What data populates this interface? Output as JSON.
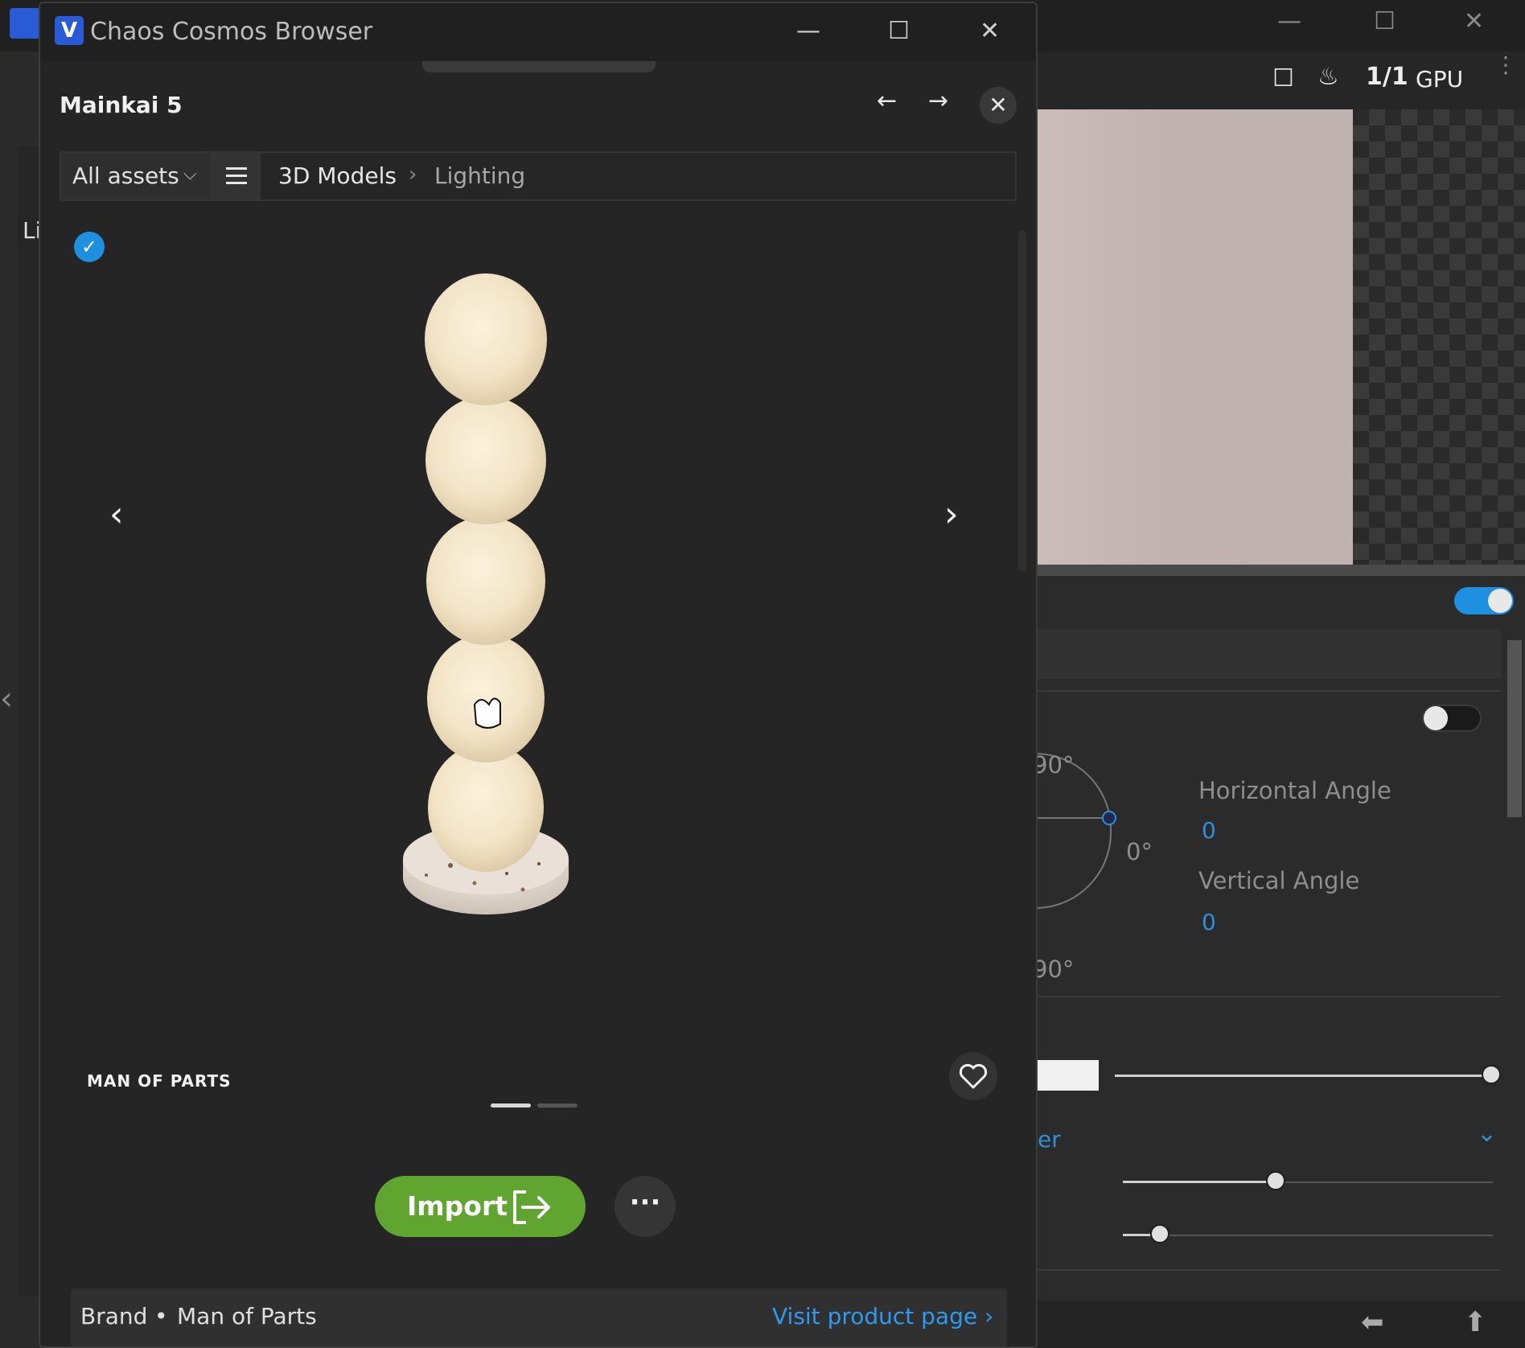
{
  "window": {
    "title": "Chaos Cosmos Browser",
    "minimize": "—",
    "maximize": "☐",
    "close": "✕"
  },
  "header": {
    "asset_name": "Mainkai 5",
    "back_icon": "arrow-left-icon",
    "forward_icon": "arrow-right-icon",
    "back_glyph": "←",
    "forward_glyph": "→",
    "close_glyph": "✕"
  },
  "nav": {
    "filter_label": "All assets",
    "filter_chevron": "⌵",
    "breadcrumb": [
      "3D Models",
      "Lighting"
    ],
    "breadcrumb_sep": "›"
  },
  "preview": {
    "check_glyph": "✓",
    "prev_glyph": "‹",
    "next_glyph": "›",
    "brand_logo_text": "MAN  OF   PARTS",
    "slide_count": 2,
    "active_slide": 1
  },
  "actions": {
    "import_label": "Import",
    "more_glyph": "···"
  },
  "info": {
    "brand_label": "Brand",
    "separator": "•",
    "brand_value": "Man of Parts",
    "visit_link": "Visit product page ›"
  },
  "background_app": {
    "left_cut_text": "Li",
    "toolbar": {
      "ratio": "1/1",
      "engine": "GPU"
    },
    "horizontal_angle_label": "Horizontal Angle",
    "horizontal_angle_value": "0",
    "vertical_angle_label": "Vertical Angle",
    "vertical_angle_value": "0",
    "dial_top": "90°",
    "dial_right": "0°",
    "dial_bottom": "90°",
    "cut_text": "er",
    "toggle_on": true,
    "toggle_off": false,
    "slider_levels": [
      1.0,
      0.5,
      0.12
    ]
  },
  "colors": {
    "accent_blue": "#1f8fe0",
    "import_green": "#5fa52f",
    "link_blue": "#2d9bf0",
    "window_bg": "#252525"
  }
}
